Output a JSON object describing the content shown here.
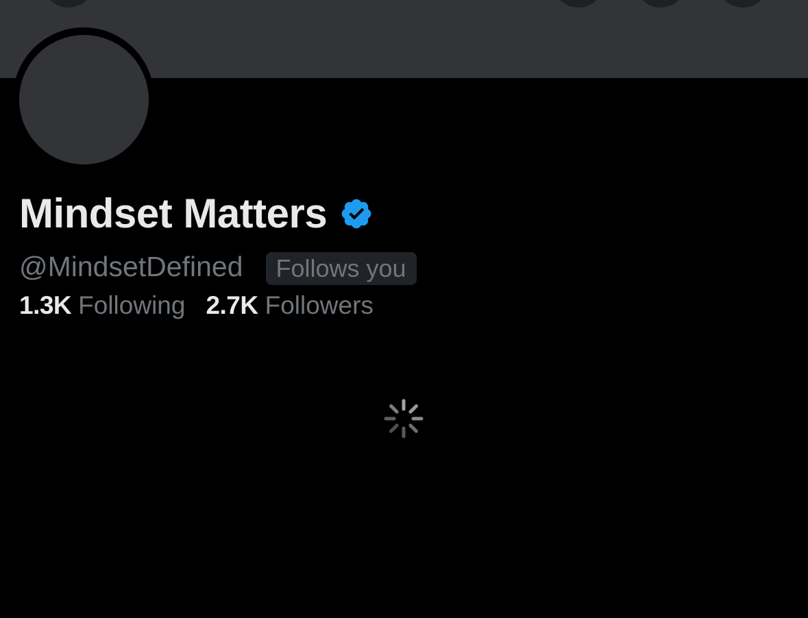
{
  "profile": {
    "display_name": "Mindset Matters",
    "verified_icon": "verified-badge-icon",
    "handle": "@MindsetDefined",
    "follows_you_label": "Follows you",
    "following_count": "1.3K",
    "following_label": "Following",
    "followers_count": "2.7K",
    "followers_label": "Followers"
  },
  "loading": {
    "icon": "loading-spinner-icon"
  },
  "colors": {
    "background": "#000000",
    "banner": "#333438",
    "primary_text": "#e7e9ea",
    "secondary_text": "#71767b",
    "badge_background": "#202327",
    "verified_blue": "#1d9bf0"
  }
}
